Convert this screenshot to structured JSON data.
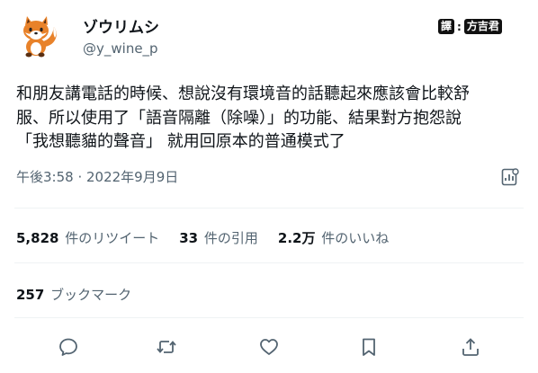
{
  "user": {
    "display_name": "ゾウリムシ",
    "handle": "@y_wine_p"
  },
  "watermark": {
    "label_1": "譯",
    "label_2": "方吉君"
  },
  "tweet": {
    "line_1": "和朋友講電話的時候、想說沒有環境音的話聽起來應該會比較舒",
    "line_2": "服、所以使用了「語音隔離（除噪）」的功能、結果對方抱怨說",
    "line_3": "「我想聽貓的聲音」 就用回原本的普通模式了"
  },
  "meta": {
    "timestamp": "午後3:58 · 2022年9月9日"
  },
  "stats": {
    "retweets_count": "5,828",
    "retweets_label": "件のリツイート",
    "quotes_count": "33",
    "quotes_label": "件の引用",
    "likes_count": "2.2万",
    "likes_label": "件のいいね",
    "bookmarks_count": "257",
    "bookmarks_label": "ブックマーク"
  },
  "icons": {
    "avatar": "fox-avatar",
    "analytics": "analytics-icon",
    "reply": "reply-icon",
    "retweet": "retweet-icon",
    "like": "heart-icon",
    "bookmark": "bookmark-icon",
    "share": "share-icon"
  },
  "colors": {
    "text": "#0f1419",
    "secondary": "#536471",
    "divider": "#eff3f4",
    "fox": "#e8822a"
  }
}
